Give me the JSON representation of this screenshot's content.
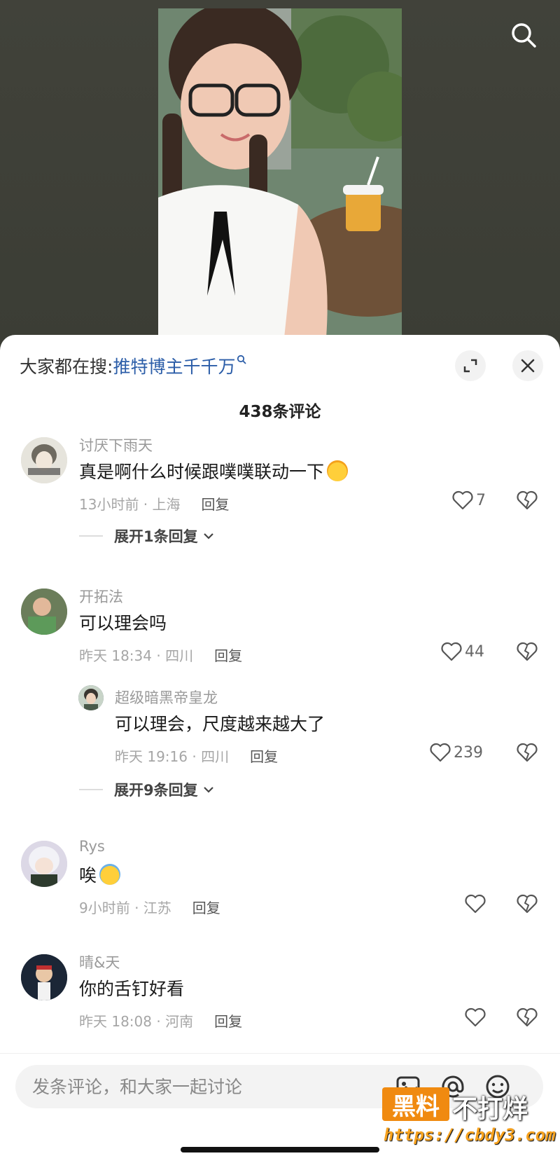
{
  "sheet": {
    "trend_prefix": "大家都在搜:",
    "trend_term": "推特博主千千万",
    "comment_count": "438条评论"
  },
  "comments": [
    {
      "user": "讨厌下雨天",
      "text": "真是啊什么时候跟噗噗联动一下",
      "emoji": "smiling-face-emoji",
      "time_location": "13小时前 · 上海",
      "reply_label": "回复",
      "likes": "7",
      "expand_label": "展开1条回复"
    },
    {
      "user": "开拓法",
      "text": "可以理会吗",
      "time_location": "昨天 18:34 · 四川",
      "reply_label": "回复",
      "likes": "44",
      "replies": [
        {
          "user": "超级暗黑帝皇龙",
          "text": "可以理会，尺度越来越大了",
          "time_location": "昨天 19:16 · 四川",
          "reply_label": "回复",
          "likes": "239"
        }
      ],
      "expand_label": "展开9条回复"
    },
    {
      "user": "Rys",
      "text": "唉",
      "emoji": "crying-face-emoji",
      "time_location": "9小时前 · 江苏",
      "reply_label": "回复",
      "likes": ""
    },
    {
      "user": "晴&天",
      "text": "你的舌钉好看",
      "time_location": "昨天 18:08 · 河南",
      "reply_label": "回复",
      "likes": ""
    }
  ],
  "input": {
    "placeholder": "发条评论，和大家一起讨论"
  },
  "watermark": {
    "box_text": "黑料",
    "text": "不打烊",
    "url": "https://cbdy3.com"
  },
  "icons": {
    "top_search": "search-icon",
    "expand": "expand-icon",
    "close": "close-icon",
    "like": "heart-icon",
    "dislike": "broken-heart-icon",
    "image": "image-icon",
    "mention": "at-icon",
    "emoji": "emoji-icon"
  },
  "colors": {
    "trend_link": "#2b5da8",
    "watermark_orange": "#f08a10"
  }
}
